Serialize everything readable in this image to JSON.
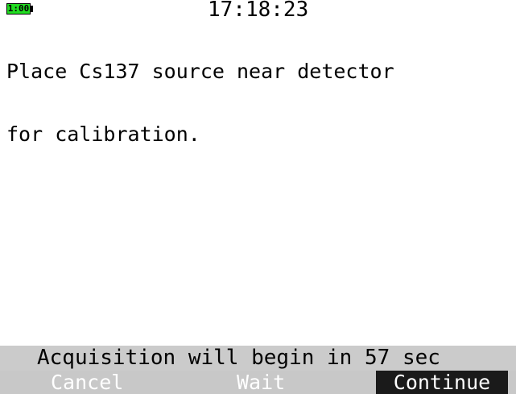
{
  "header": {
    "battery_label": "1:00",
    "clock": "17:18:23"
  },
  "message": {
    "lines": [
      "Place Cs137 source near detector",
      "for calibration."
    ]
  },
  "status": {
    "text": "Acquisition will begin in 57 sec"
  },
  "softkeys": {
    "cancel": "Cancel",
    "wait": "Wait",
    "continue": "Continue"
  },
  "colors": {
    "battery": "#22dd22",
    "status_bar": "#cbcbcb",
    "softkey_bar": "#c8c8c8",
    "selected_softkey": "#1a1a1a"
  }
}
